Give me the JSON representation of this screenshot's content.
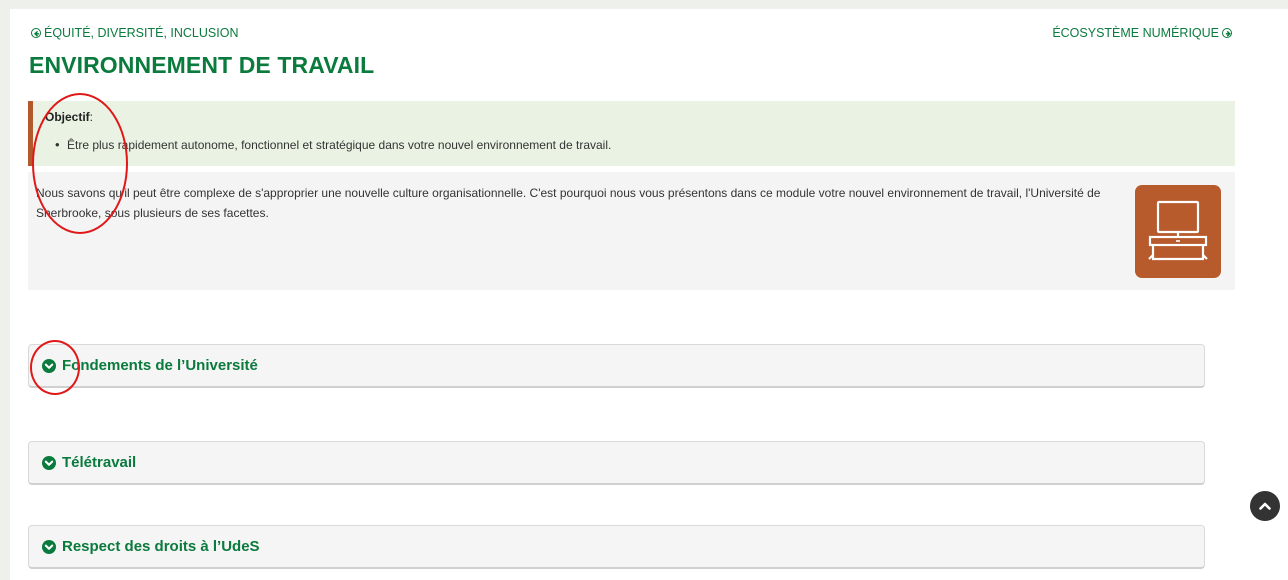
{
  "nav": {
    "prev_label": "ÉQUITÉ, DIVERSITÉ, INCLUSION",
    "next_label": "ÉCOSYSTÈME NUMÉRIQUE"
  },
  "page": {
    "title": "ENVIRONNEMENT DE TRAVAIL"
  },
  "objective": {
    "label": "Objectif",
    "suffix": ":",
    "items": [
      "Être plus rapidement autonome, fonctionnel et stratégique dans votre nouvel environnement de travail."
    ]
  },
  "intro": {
    "text": "Nous savons qu'il peut être complexe de s'approprier une nouvelle culture organisationnelle. C'est pourquoi nous vous présentons dans ce module votre nouvel environnement de travail, l'Université de Sherbrooke, sous plusieurs de ses facettes.",
    "icon": "desk-monitor-icon"
  },
  "accordions": [
    {
      "label": "Fondements de l’Université"
    },
    {
      "label": "Télétravail"
    },
    {
      "label": "Respect des droits à l’UdeS"
    }
  ],
  "colors": {
    "brand_green": "#0a7a3d",
    "accent_brown": "#b75a2c",
    "objective_bg": "#eaf3e3",
    "annotation_red": "#e01818"
  }
}
